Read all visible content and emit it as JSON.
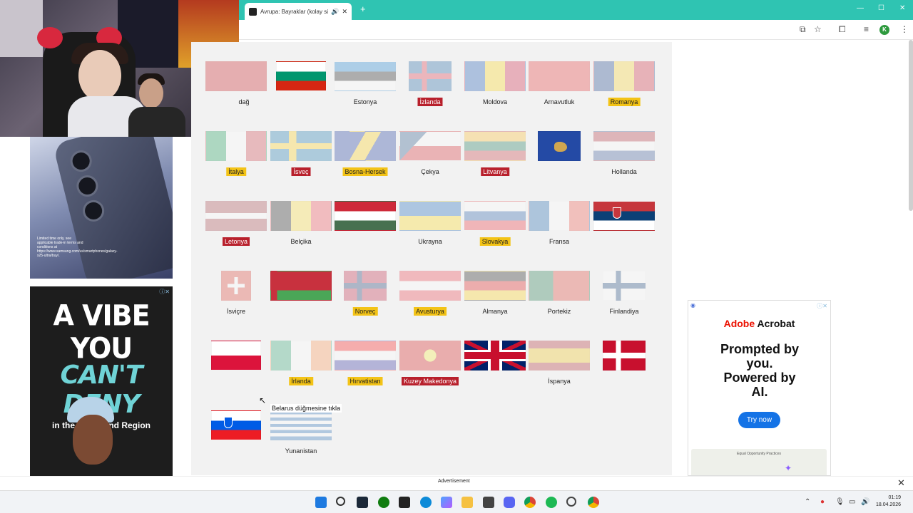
{
  "browser": {
    "tab_title": "Avrupa: Bayraklar (kolay sü",
    "new_tab": "+",
    "profile_initial": "K"
  },
  "game": {
    "tooltip": "Belarus düğmesine tıkla",
    "flags": [
      {
        "name": "flag-montenegro",
        "label": "dağ",
        "state": "faded",
        "style": "plain",
        "colors": [
          "#c40308",
          "#c40308"
        ],
        "label_style": "plain"
      },
      {
        "name": "flag-bulgaria",
        "label": "",
        "state": "remaining",
        "colors": [
          "#ffffff",
          "#00966e",
          "#d62612"
        ]
      },
      {
        "name": "flag-estonia",
        "label": "Estonya",
        "state": "faded",
        "colors": [
          "#0072ce",
          "#000000",
          "#ffffff"
        ],
        "label_style": "plain"
      },
      {
        "name": "flag-iceland",
        "label": "İzlanda",
        "state": "faded",
        "label_style": "red"
      },
      {
        "name": "flag-moldova",
        "label": "Moldova",
        "state": "faded",
        "label_style": "plain"
      },
      {
        "name": "flag-albania",
        "label": "Arnavutluk",
        "state": "faded",
        "label_style": "plain"
      },
      {
        "name": "flag-romania",
        "label": "Romanya",
        "state": "faded",
        "label_style": "yellow"
      },
      {
        "name": "flag-italy",
        "label": "İtalya",
        "state": "faded",
        "label_style": "yellow"
      },
      {
        "name": "flag-sweden",
        "label": "İsveç",
        "state": "faded",
        "label_style": "red"
      },
      {
        "name": "flag-bosnia",
        "label": "Bosna-Hersek",
        "state": "faded",
        "label_style": "yellow"
      },
      {
        "name": "flag-czechia",
        "label": "Çekya",
        "state": "faded",
        "label_style": "plain"
      },
      {
        "name": "flag-lithuania",
        "label": "Litvanya",
        "state": "faded",
        "label_style": "red"
      },
      {
        "name": "flag-kosovo",
        "label": "",
        "state": "remaining"
      },
      {
        "name": "flag-netherlands",
        "label": "Hollanda",
        "state": "faded",
        "label_style": "plain"
      },
      {
        "name": "flag-latvia",
        "label": "Letonya",
        "state": "faded",
        "label_style": "red"
      },
      {
        "name": "flag-belgium",
        "label": "Belçika",
        "state": "faded",
        "label_style": "plain"
      },
      {
        "name": "flag-hungary",
        "label": "",
        "state": "remaining"
      },
      {
        "name": "flag-ukraine",
        "label": "Ukrayna",
        "state": "faded",
        "label_style": "plain"
      },
      {
        "name": "flag-slovakia",
        "label": "Slovakya",
        "state": "faded",
        "label_style": "yellow"
      },
      {
        "name": "flag-france",
        "label": "Fransa",
        "state": "faded",
        "label_style": "plain"
      },
      {
        "name": "flag-serbia",
        "label": "",
        "state": "remaining"
      },
      {
        "name": "flag-switzerland",
        "label": "İsviçre",
        "state": "faded",
        "label_style": "plain"
      },
      {
        "name": "flag-belarus",
        "label": "",
        "state": "remaining"
      },
      {
        "name": "flag-norway",
        "label": "Norveç",
        "state": "faded",
        "label_style": "yellow"
      },
      {
        "name": "flag-austria",
        "label": "Avusturya",
        "state": "faded",
        "label_style": "yellow"
      },
      {
        "name": "flag-germany",
        "label": "Almanya",
        "state": "faded",
        "label_style": "plain"
      },
      {
        "name": "flag-portugal",
        "label": "Portekiz",
        "state": "faded",
        "label_style": "plain"
      },
      {
        "name": "flag-finland",
        "label": "Finlandiya",
        "state": "faded",
        "label_style": "plain"
      },
      {
        "name": "flag-poland",
        "label": "",
        "state": "remaining"
      },
      {
        "name": "flag-ireland",
        "label": "İrlanda",
        "state": "faded",
        "label_style": "yellow"
      },
      {
        "name": "flag-croatia",
        "label": "Hırvatistan",
        "state": "faded",
        "label_style": "yellow"
      },
      {
        "name": "flag-north-macedonia",
        "label": "Kuzey Makedonya",
        "state": "faded",
        "label_style": "red"
      },
      {
        "name": "flag-united-kingdom",
        "label": "",
        "state": "remaining"
      },
      {
        "name": "flag-spain",
        "label": "İspanya",
        "state": "faded",
        "label_style": "plain"
      },
      {
        "name": "flag-denmark",
        "label": "",
        "state": "remaining"
      },
      {
        "name": "flag-slovenia",
        "label": "",
        "state": "remaining"
      },
      {
        "name": "flag-greece",
        "label": "Yunanistan",
        "state": "faded",
        "label_style": "plain"
      }
    ]
  },
  "ads": {
    "samsung_fine_print": "Limited time only, see applicable trade-in terms and conditions at https://www.samsung.com/us/smartphones/galaxy-s25-ultra/buy/.",
    "richmond_line1": "A VIBE YOU",
    "richmond_line2": "CAN'T DENY",
    "richmond_line3": "in the Richmond Region",
    "acrobat_brand_a": "Adobe",
    "acrobat_brand_b": " Acrobat",
    "acrobat_pitch": "Prompted by you. Powered by AI.",
    "acrobat_button": "Try now",
    "acrobat_doc_title": "Equal Opportunity Practices",
    "advertisement_label": "Advertisement"
  },
  "taskbar": {
    "time": "01:19",
    "date": "18.04.2026"
  },
  "colors": {
    "tabstrip": "#2fc4b2",
    "label_red": "#b8202c",
    "label_yellow": "#f3c316"
  }
}
